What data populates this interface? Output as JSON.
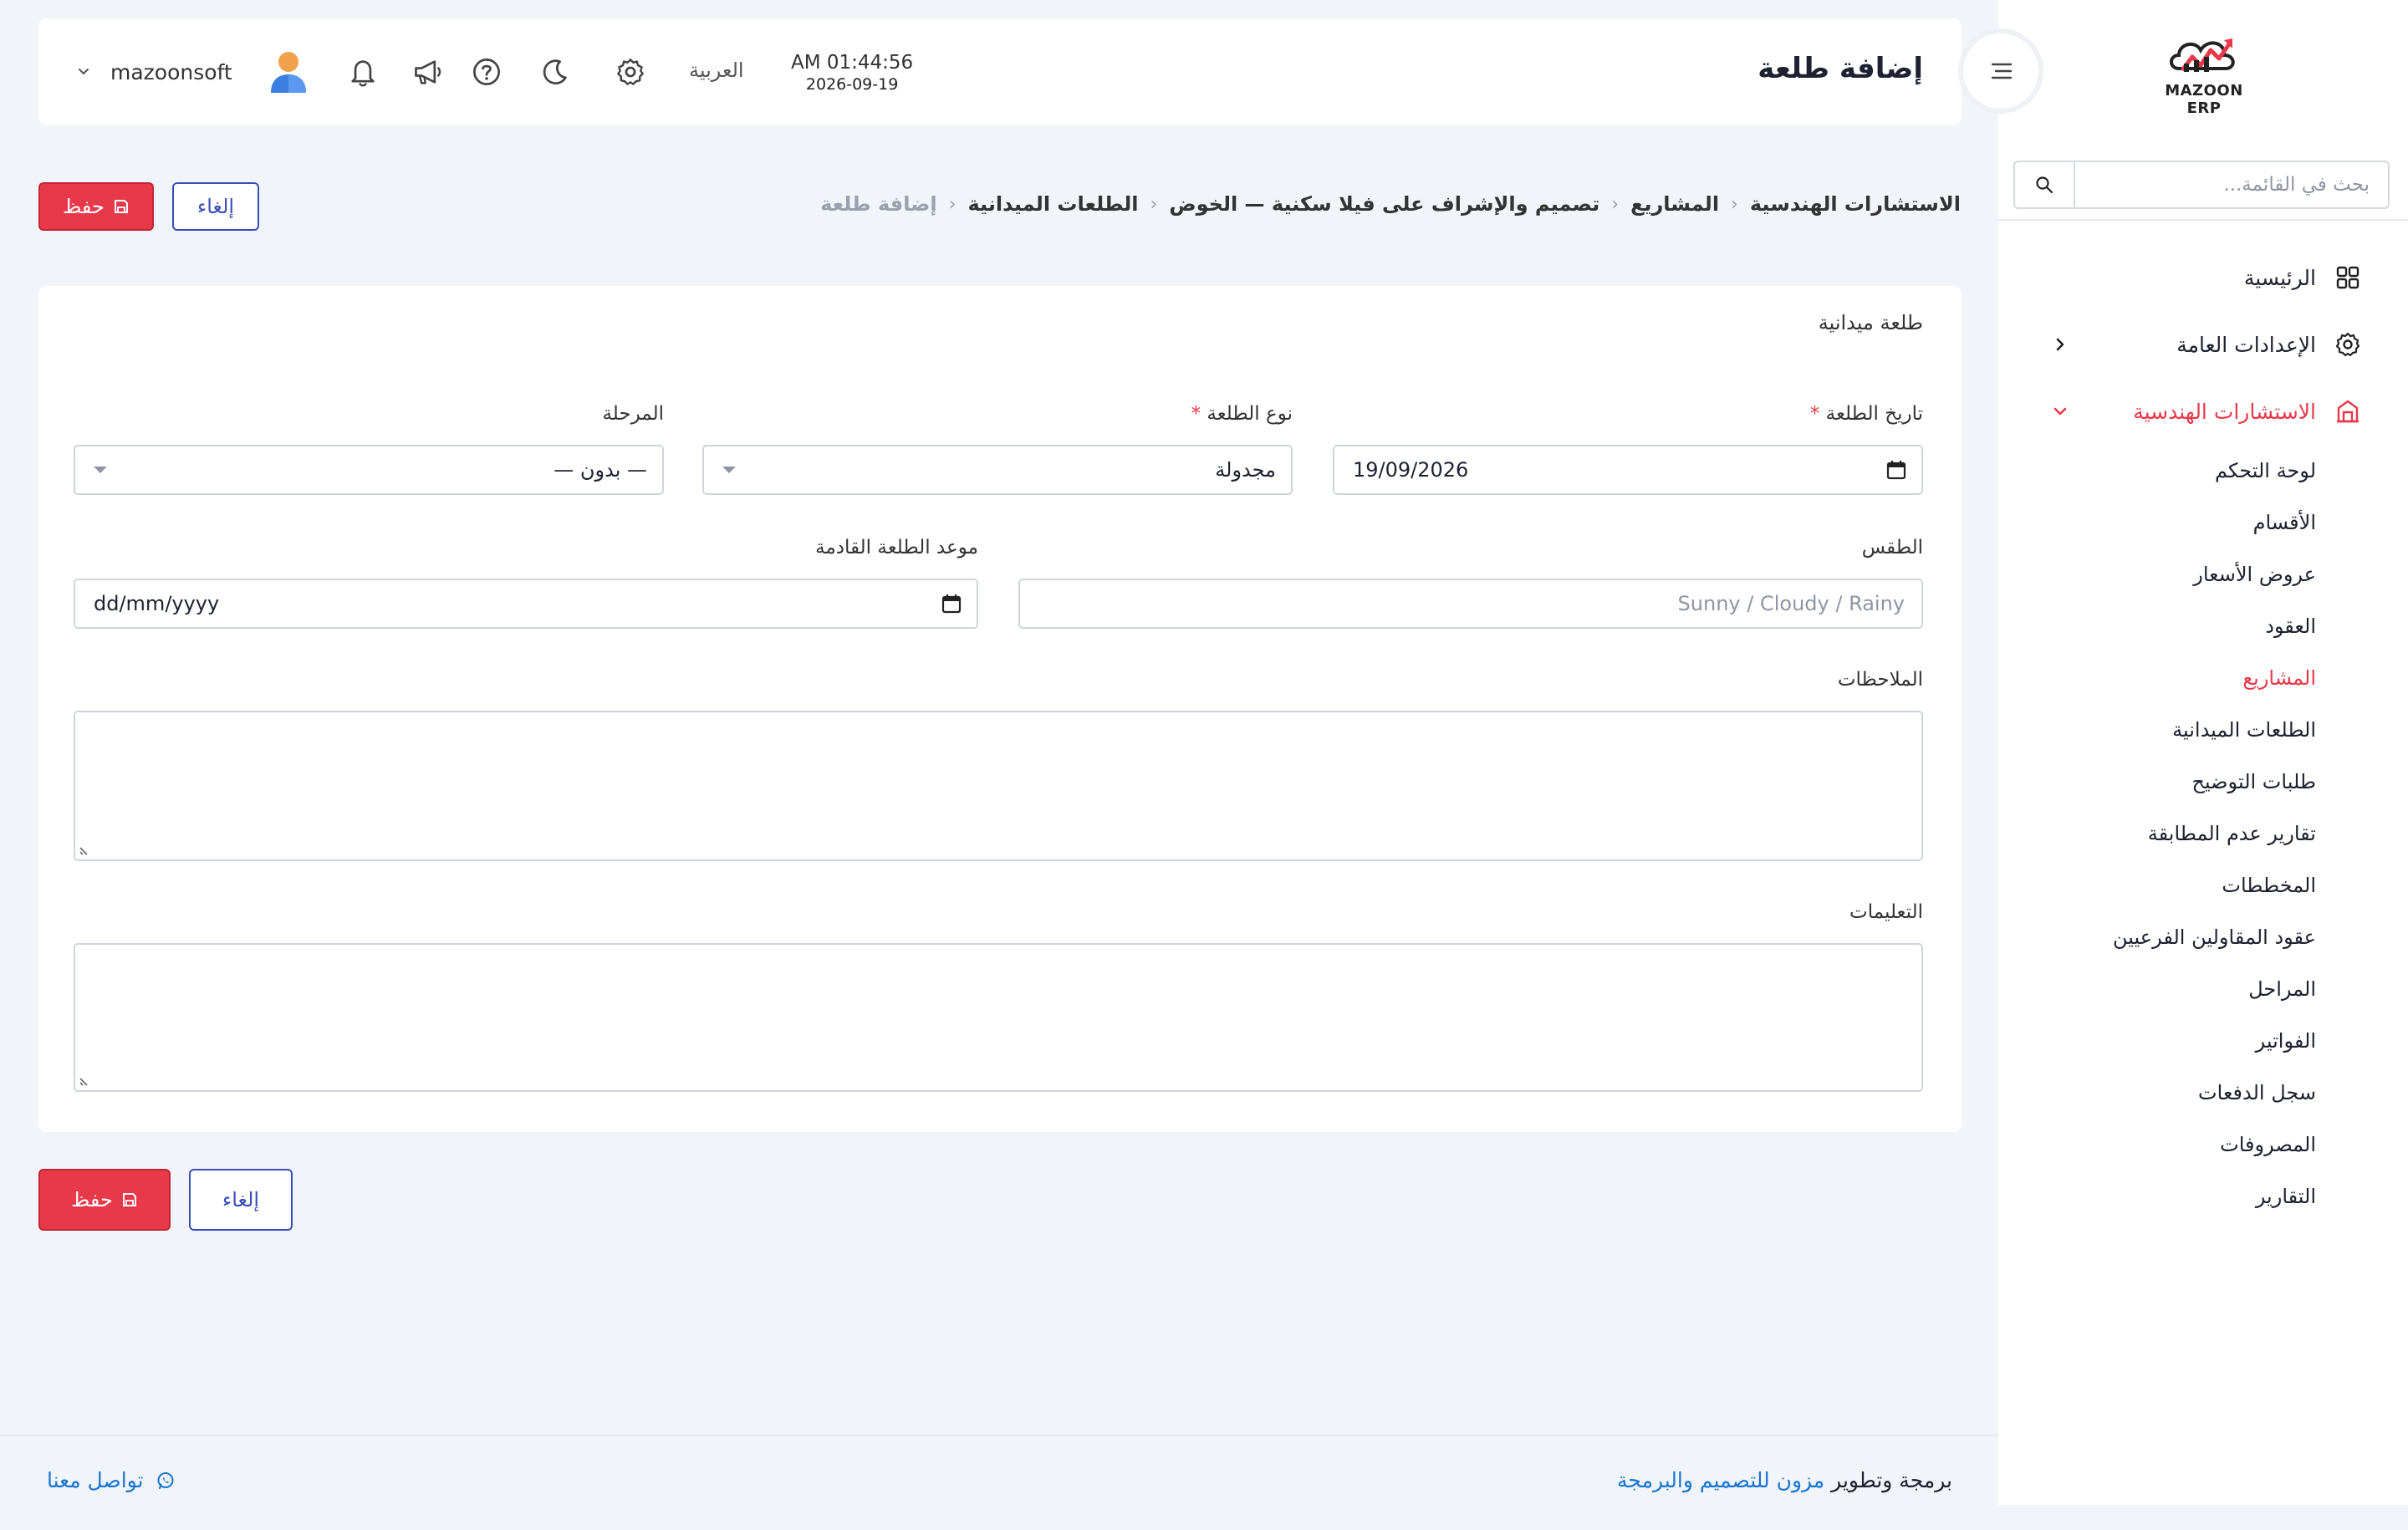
{
  "sidebar": {
    "logo_text": "MAZOON ERP",
    "search_placeholder": "بحث في القائمة...",
    "items": [
      {
        "label": "الرئيسية"
      },
      {
        "label": "الإعدادات العامة"
      },
      {
        "label": "الاستشارات الهندسية"
      }
    ],
    "sub_items": [
      {
        "label": "لوحة التحكم"
      },
      {
        "label": "الأقسام"
      },
      {
        "label": "عروض الأسعار"
      },
      {
        "label": "العقود"
      },
      {
        "label": "المشاريع"
      },
      {
        "label": "الطلعات الميدانية"
      },
      {
        "label": "طلبات التوضيح"
      },
      {
        "label": "تقارير عدم المطابقة"
      },
      {
        "label": "المخططات"
      },
      {
        "label": "عقود المقاولين الفرعيين"
      },
      {
        "label": "المراحل"
      },
      {
        "label": "الفواتير"
      },
      {
        "label": "سجل الدفعات"
      },
      {
        "label": "المصروفات"
      },
      {
        "label": "التقارير"
      }
    ]
  },
  "header": {
    "title": "إضافة طلعة",
    "time": "AM 01:44:56",
    "date": "2026-09-19",
    "language": "العربية",
    "username": "mazoonsoft"
  },
  "breadcrumb": {
    "items": [
      {
        "label": "الاستشارات الهندسية"
      },
      {
        "label": "المشاريع"
      },
      {
        "label": "تصميم والإشراف على فيلا سكنية — الخوض"
      },
      {
        "label": "الطلعات الميدانية"
      }
    ],
    "current": "إضافة طلعة"
  },
  "actions": {
    "save_label": "حفظ",
    "cancel_label": "إلغاء"
  },
  "form": {
    "card_title": "طلعة ميدانية",
    "required_mark": "*",
    "visit_date": {
      "label": "تاريخ الطلعة",
      "value": "19/09/2026"
    },
    "visit_type": {
      "label": "نوع الطلعة",
      "value": "مجدولة"
    },
    "phase": {
      "label": "المرحلة",
      "value": "— بدون —"
    },
    "weather": {
      "label": "الطقس",
      "placeholder": "Sunny / Cloudy / Rainy"
    },
    "next_visit": {
      "label": "موعد الطلعة القادمة",
      "value": "dd/mm/yyyy"
    },
    "notes": {
      "label": "الملاحظات"
    },
    "instructions": {
      "label": "التعليمات"
    }
  },
  "footer": {
    "credit_prefix": "برمجة وتطوير",
    "credit_link": "مزون للتصميم والبرمجة",
    "contact_label": "تواصل معنا"
  },
  "colors": {
    "accent_red": "#e8394a",
    "primary_blue": "#3b4db8",
    "link_blue": "#1976d2",
    "background": "#f1f4f8"
  }
}
